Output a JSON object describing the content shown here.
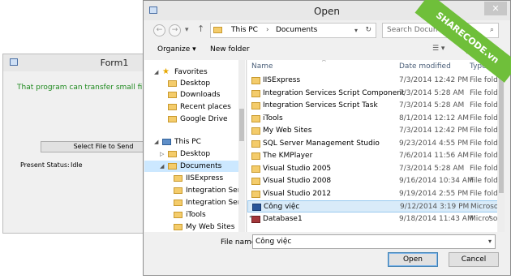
{
  "form1": {
    "title": "Form1",
    "info_text": "That program can transfer small file. I'",
    "select_button": "Select File to Send",
    "status_label": "Present Status:",
    "status_value": "Idle"
  },
  "dialog": {
    "title": "Open",
    "close_glyph": "✕",
    "address": {
      "crumbs": [
        "This PC",
        "Documents"
      ],
      "separator": "›"
    },
    "search_placeholder": "Search Documents",
    "toolbar": {
      "organize": "Organize ▾",
      "new_folder": "New folder",
      "help": "?"
    },
    "nav_tree": [
      {
        "label": "Favorites",
        "icon": "star-icon",
        "indent": 0
      },
      {
        "label": "Desktop",
        "icon": "folder-icon",
        "indent": 1
      },
      {
        "label": "Downloads",
        "icon": "folder-icon",
        "indent": 1
      },
      {
        "label": "Recent places",
        "icon": "folder-icon",
        "indent": 1
      },
      {
        "label": "Google Drive",
        "icon": "folder-icon",
        "indent": 1
      },
      {
        "label": "This PC",
        "icon": "computer-icon",
        "indent": 0
      },
      {
        "label": "Desktop",
        "icon": "folder-icon",
        "indent": 1
      },
      {
        "label": "Documents",
        "icon": "folder-icon",
        "indent": 1
      },
      {
        "label": "IISExpress",
        "icon": "folder-icon",
        "indent": 2
      },
      {
        "label": "Integration Ser",
        "icon": "folder-icon",
        "indent": 2
      },
      {
        "label": "Integration Ser",
        "icon": "folder-icon",
        "indent": 2
      },
      {
        "label": "iTools",
        "icon": "folder-icon",
        "indent": 2
      },
      {
        "label": "My Web Sites",
        "icon": "folder-icon",
        "indent": 2
      }
    ],
    "columns": {
      "name": "Name",
      "date": "Date modified",
      "type": "Type"
    },
    "files": [
      {
        "name": "IISExpress",
        "date": "7/3/2014 12:42 PM",
        "type": "File folde",
        "icon": "folder-icon"
      },
      {
        "name": "Integration Services Script Component",
        "date": "7/3/2014 5:28 AM",
        "type": "File folde",
        "icon": "folder-icon"
      },
      {
        "name": "Integration Services Script Task",
        "date": "7/3/2014 5:28 AM",
        "type": "File folde",
        "icon": "folder-icon"
      },
      {
        "name": "iTools",
        "date": "8/1/2014 12:12 AM",
        "type": "File folde",
        "icon": "folder-icon"
      },
      {
        "name": "My Web Sites",
        "date": "7/3/2014 12:42 PM",
        "type": "File folde",
        "icon": "folder-icon"
      },
      {
        "name": "SQL Server Management Studio",
        "date": "9/23/2014 4:55 PM",
        "type": "File folde",
        "icon": "folder-icon"
      },
      {
        "name": "The KMPlayer",
        "date": "7/6/2014 11:56 AM",
        "type": "File folde",
        "icon": "folder-icon"
      },
      {
        "name": "Visual Studio 2005",
        "date": "7/3/2014 5:28 AM",
        "type": "File folde",
        "icon": "folder-icon"
      },
      {
        "name": "Visual Studio 2008",
        "date": "9/16/2014 10:34 AM",
        "type": "File folde",
        "icon": "folder-icon"
      },
      {
        "name": "Visual Studio 2012",
        "date": "9/19/2014 2:55 PM",
        "type": "File folde",
        "icon": "folder-icon"
      },
      {
        "name": "Công việc",
        "date": "9/12/2014 3:19 PM",
        "type": "Microsoft",
        "icon": "word-doc-icon"
      },
      {
        "name": "Database1",
        "date": "9/18/2014 11:43 AM",
        "type": "Microsoft",
        "icon": "access-db-icon"
      }
    ],
    "selected_file_index": 10,
    "file_name_label": "File name:",
    "file_name_value": "Công việc",
    "open_button": "Open",
    "cancel_button": "Cancel"
  },
  "watermark": "SHARECODE.vn",
  "colors": {
    "info_text": "#1f8a1f",
    "selection": "#cce8ff",
    "watermark_band": "#6fbf3a"
  }
}
